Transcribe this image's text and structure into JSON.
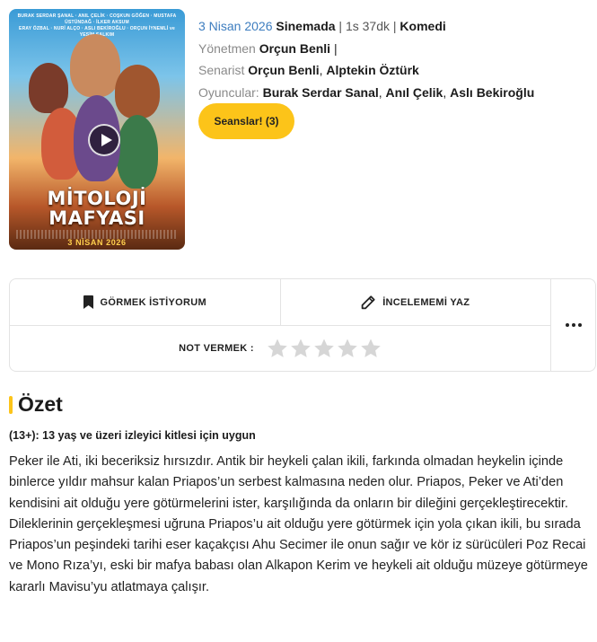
{
  "poster": {
    "credits_line1": "BURAK SERDAR ŞANAL · ANIL ÇELİK · COŞKUN GÖĞEN · MUSTAFA ÜSTÜNDAĞ · İLKER AKSUM",
    "credits_line2": "ERAY ÖZBAL · NURİ ALÇO · ASLI BEKİROĞLU · ORÇUN İYNEMLİ ve YEŞİM SALKIM",
    "title_line1": "MİTOLOJİ",
    "title_line2": "MAFYASI",
    "release_date": "3 NİSAN 2026"
  },
  "movie": {
    "date": "3 Nisan 2026",
    "venue": "Sinemada",
    "sep1": " | 1s 37dk | ",
    "genre": "Komedi",
    "director_label": "Yönetmen",
    "director": "Orçun Benli",
    "director_trailing": " |",
    "writer_label": "Senarist",
    "writers": [
      "Orçun Benli",
      "Alptekin Öztürk"
    ],
    "cast_label": "Oyuncular:",
    "cast": [
      "Burak Serdar Sanal",
      "Anıl Çelik",
      "Aslı Bekiroğlu"
    ],
    "comma": ", ",
    "seans_button": "Seanslar! (3)"
  },
  "actions": {
    "watchlist": "GÖRMEK İSTİYORUM",
    "review": "İNCELEMEMİ YAZ",
    "rate_label": "NOT VERMEK :",
    "rating": 0,
    "max_rating": 5
  },
  "summary": {
    "heading": "Özet",
    "age_rating": "(13+): 13 yaş ve üzeri izleyici kitlesi için uygun",
    "text": "Peker ile Ati, iki beceriksiz hırsızdır. Antik bir heykeli çalan ikili, farkında olmadan heykelin içinde binlerce yıldır mahsur kalan Priapos’un serbest kalmasına neden olur. Priapos, Peker ve Ati’den kendisini ait olduğu yere götürmelerini ister, karşılığında da onların bir dileğini gerçekleştirecektir. Dileklerinin gerçekleşmesi uğruna Priapos’u ait olduğu yere götürmek için yola çıkan ikili, bu sırada Priapos’un peşindeki tarihi eser kaçakçısı Ahu Secimer ile onun sağır ve kör iz sürücüleri Poz Recai ve Mono Rıza’yı, eski bir mafya babası olan Alkapon Kerim ve heykeli ait olduğu müzeye götürmeye kararlı Mavisu’yu atlatmaya çalışır."
  },
  "colors": {
    "accent": "#fcc419",
    "link_blue": "#3d7dbf",
    "label_gray": "#8a8a8a",
    "star_empty": "#d6d6d6"
  }
}
